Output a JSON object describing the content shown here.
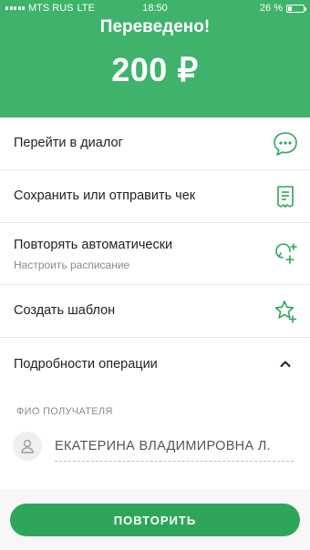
{
  "status_bar": {
    "carrier": "MTS RUS",
    "network": "LTE",
    "time": "18:50",
    "battery": "26 %",
    "battery_level": 0.26
  },
  "header": {
    "title": "Переведено!",
    "amount": "200 ₽",
    "color": "#3fb36b"
  },
  "actions": [
    {
      "label": "Перейти в диалог",
      "icon": "chat-icon"
    },
    {
      "label": "Сохранить или отправить чек",
      "icon": "receipt-icon"
    },
    {
      "label": "Повторять автоматически",
      "sublabel": "Настроить расписание",
      "icon": "schedule-add-icon"
    },
    {
      "label": "Создать шаблон",
      "icon": "star-add-icon"
    },
    {
      "label": "Подробности операции",
      "icon": "chevron-up-icon"
    }
  ],
  "details": {
    "recipient_caption": "ФИО ПОЛУЧАТЕЛЯ",
    "recipient_name": "ЕКАТЕРИНА ВЛАДИМИРОВНА Л."
  },
  "repeat_button": {
    "label": "ПОВТОРИТЬ",
    "color": "#2ea65a"
  }
}
